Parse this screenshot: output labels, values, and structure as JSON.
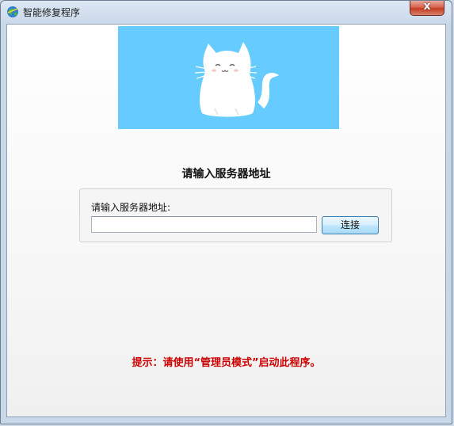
{
  "window": {
    "title": "智能修复程序",
    "close_symbol": "x"
  },
  "icons": {
    "app": "app-globe-icon",
    "close": "close-icon",
    "banner": "cat-illustration"
  },
  "banner": {
    "background_color": "#66ccff"
  },
  "main": {
    "heading": "请输入服务器地址",
    "field_label": "请输入服务器地址:",
    "server_input_value": "",
    "connect_label": "连接",
    "hint": "提示：请使用“管理员模式”启动此程序。"
  },
  "colors": {
    "hint": "#cc0000",
    "button_border": "#3c7fb1"
  }
}
